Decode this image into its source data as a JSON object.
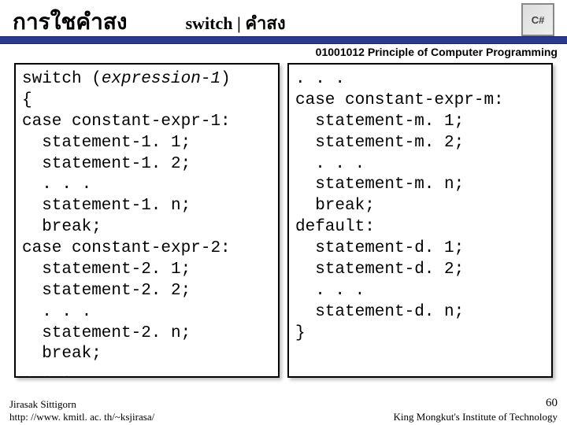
{
  "header": {
    "title_main": "การใชคำสง",
    "title_sub": "switch | คำสง",
    "logo_text": "C#",
    "course": "01001012 Principle of Computer Programming"
  },
  "code_left": {
    "l1a": "switch (",
    "l1b": "expression-1",
    "l1c": ")",
    "l2": "{",
    "l3": "case constant-expr-1:",
    "l4": "statement-1. 1;",
    "l5": "statement-1. 2;",
    "l6": ". . .",
    "l7": "statement-1. n;",
    "l8": "break;",
    "l9": "case constant-expr-2:",
    "l10": "statement-2. 1;",
    "l11": "statement-2. 2;",
    "l12": ". . .",
    "l13": "statement-2. n;",
    "l14": "break;",
    "l15": ". . .",
    "l16": ". . ."
  },
  "code_right": {
    "l1": ". . .",
    "l2": "case constant-expr-m:",
    "l3": "statement-m. 1;",
    "l4": "statement-m. 2;",
    "l5": ". . .",
    "l6": "statement-m. n;",
    "l7": "break;",
    "l8": "default:",
    "l9": "statement-d. 1;",
    "l10": "statement-d. 2;",
    "l11": ". . .",
    "l12": "statement-d. n;",
    "l13": "}"
  },
  "footer": {
    "author": "Jirasak Sittigorn",
    "url": "http: //www. kmitl. ac. th/~ksjirasa/",
    "page": "60",
    "institute": "King Mongkut's Institute of Technology"
  }
}
